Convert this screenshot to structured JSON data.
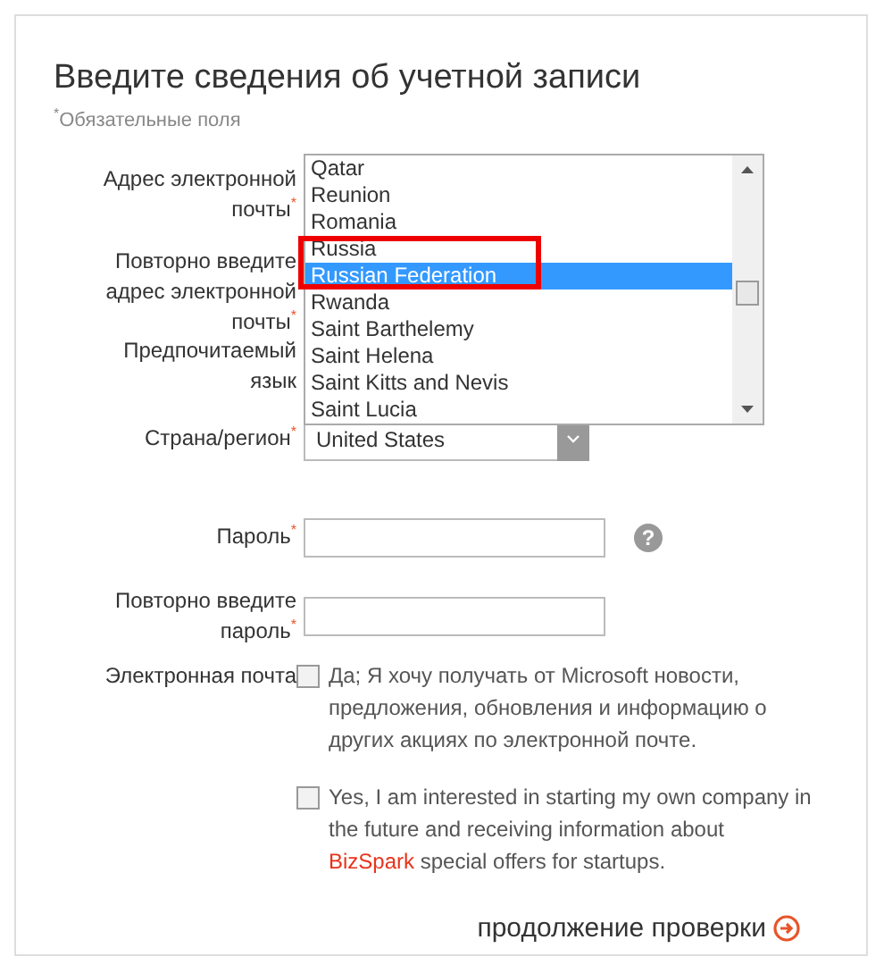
{
  "title": "Введите сведения об учетной записи",
  "required_note": "$^{*}$Обязательные поля",
  "fields": [
    {
      "kind": "email",
      "label": "Адрес электронной почты$^{*}$"
    },
    {
      "kind": "email-repeat",
      "label": "Повторно введите адрес электронной почты$^{*}$"
    },
    {
      "kind": "language",
      "label": "Предпочитаемый язык"
    },
    {
      "kind": "country",
      "label": "Страна/регион$^{*}$",
      "value": "United States"
    },
    {
      "kind": "password",
      "label": "Пароль$^{*}$",
      "help": "?"
    },
    {
      "kind": "password-repeat",
      "label": "Повторно введите пароль$^{*}$"
    }
  ],
  "country_list": [
    {
      "label": "Qatar",
      "selected": false
    },
    {
      "label": "Reunion",
      "selected": false
    },
    {
      "label": "Romania",
      "selected": false
    },
    {
      "label": "Russia",
      "selected": false
    },
    {
      "label": "Russian Federation",
      "selected": true
    },
    {
      "label": "Rwanda",
      "selected": false
    },
    {
      "label": "Saint Barthelemy",
      "selected": false
    },
    {
      "label": "Saint Helena",
      "selected": false
    },
    {
      "label": "Saint Kitts and Nevis",
      "selected": false
    },
    {
      "label": "Saint Lucia",
      "selected": false
    }
  ],
  "email_label": "Электронная почта",
  "options": [
    {
      "checked": false,
      "text": "Да; Я хочу получать от Microsoft новости, предложения, обновления и информацию о других акциях по электронной почте."
    },
    {
      "checked": false,
      "text": "Yes, I am interested in starting my own company in the future and receiving information about ",
      "link": "BizSpark",
      "after": " special offers for startups."
    }
  ],
  "continue": "продолжение проверки"
}
